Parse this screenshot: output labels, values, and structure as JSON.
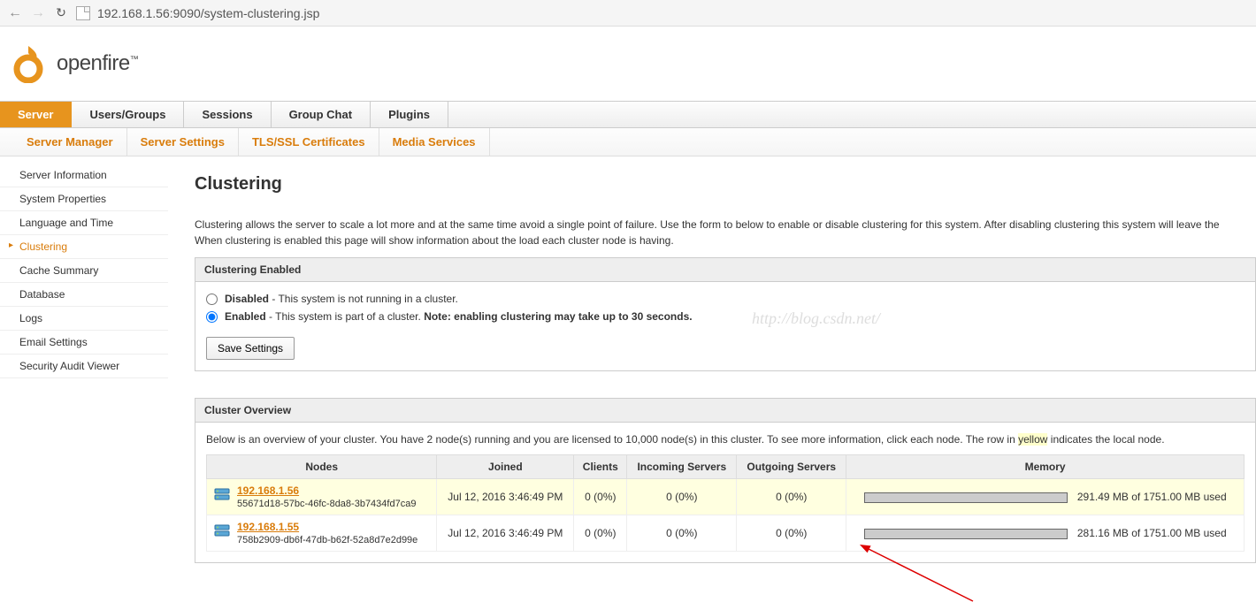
{
  "browser": {
    "url": "192.168.1.56:9090/system-clustering.jsp"
  },
  "logo": {
    "text": "openfire"
  },
  "main_tabs": [
    "Server",
    "Users/Groups",
    "Sessions",
    "Group Chat",
    "Plugins"
  ],
  "sub_tabs": [
    "Server Manager",
    "Server Settings",
    "TLS/SSL Certificates",
    "Media Services"
  ],
  "sidebar": [
    "Server Information",
    "System Properties",
    "Language and Time",
    "Clustering",
    "Cache Summary",
    "Database",
    "Logs",
    "Email Settings",
    "Security Audit Viewer"
  ],
  "page": {
    "title": "Clustering",
    "intro": "Clustering allows the server to scale a lot more and at the same time avoid a single point of failure. Use the form to below to enable or disable clustering for this system. After disabling clustering this system will leave the",
    "intro2": "When clustering is enabled this page will show information about the load each cluster node is having."
  },
  "enabled_panel": {
    "title": "Clustering Enabled",
    "disabled_label": "Disabled",
    "disabled_desc": " - This system is not running in a cluster.",
    "enabled_label": "Enabled",
    "enabled_desc_pre": " - This system is part of a cluster. ",
    "enabled_desc_bold": "Note: enabling clustering may take up to 30 seconds.",
    "save": "Save Settings"
  },
  "overview_panel": {
    "title": "Cluster Overview",
    "desc_pre": "Below is an overview of your cluster. You have 2 node(s) running and you are licensed to 10,000 node(s) in this cluster. To see more information, click each node. The row in ",
    "desc_yellow": "yellow",
    "desc_post": " indicates the local node.",
    "headers": {
      "node": "Nodes",
      "joined": "Joined",
      "clients": "Clients",
      "incoming": "Incoming Servers",
      "outgoing": "Outgoing Servers",
      "memory": "Memory"
    },
    "rows": [
      {
        "ip": "192.168.1.56",
        "uuid": "55671d18-57bc-46fc-8da8-3b7434fd7ca9",
        "joined": "Jul 12, 2016 3:46:49 PM",
        "clients": "0 (0%)",
        "incoming": "0 (0%)",
        "outgoing": "0 (0%)",
        "mem_pct": 17,
        "mem_text": "291.49 MB of 1751.00 MB used",
        "local": true
      },
      {
        "ip": "192.168.1.55",
        "uuid": "758b2909-db6f-47db-b62f-52a8d7e2d99e",
        "joined": "Jul 12, 2016 3:46:49 PM",
        "clients": "0 (0%)",
        "incoming": "0 (0%)",
        "outgoing": "0 (0%)",
        "mem_pct": 16,
        "mem_text": "281.16 MB of 1751.00 MB used",
        "local": false
      }
    ]
  },
  "watermark": "http://blog.csdn.net/"
}
